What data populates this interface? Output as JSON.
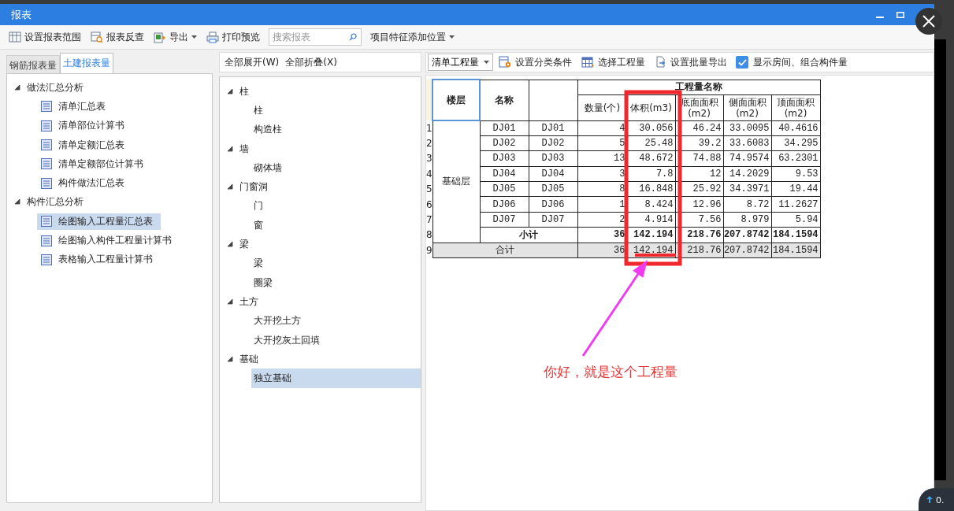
{
  "window": {
    "title": "报表"
  },
  "toolbar": [
    {
      "kind": "button",
      "label": "设置报表范围"
    },
    {
      "kind": "button",
      "label": "报表反查"
    },
    {
      "kind": "dropdown",
      "label": "导出"
    },
    {
      "kind": "button",
      "label": "打印预览"
    },
    {
      "kind": "search",
      "placeholder": "搜索报表"
    },
    {
      "kind": "dropdown",
      "label": "项目特征添加位置"
    }
  ],
  "report_tabs": [
    {
      "label": "钢筋报表量",
      "selected": false
    },
    {
      "label": "土建报表量",
      "selected": true
    }
  ],
  "report_tree": [
    {
      "label": "做法汇总分析",
      "expanded": true,
      "children": [
        {
          "label": "清单汇总表",
          "selected": false
        },
        {
          "label": "清单部位计算书",
          "selected": false
        },
        {
          "label": "清单定额汇总表",
          "selected": false
        },
        {
          "label": "清单定额部位计算书",
          "selected": false
        },
        {
          "label": "构件做法汇总表",
          "selected": false
        }
      ]
    },
    {
      "label": "构件汇总分析",
      "expanded": true,
      "children": [
        {
          "label": "绘图输入工程量汇总表",
          "selected": true
        },
        {
          "label": "绘图输入构件工程量计算书",
          "selected": false
        },
        {
          "label": "表格输入工程量计算书",
          "selected": false
        }
      ]
    }
  ],
  "component_actions": [
    "全部展开(W)",
    "全部折叠(X)"
  ],
  "component_tree": [
    {
      "label": "柱",
      "expanded": true,
      "children": [
        {
          "label": "柱",
          "selected": false
        },
        {
          "label": "构造柱",
          "selected": false
        }
      ]
    },
    {
      "label": "墙",
      "expanded": true,
      "children": [
        {
          "label": "砌体墙",
          "selected": false
        }
      ]
    },
    {
      "label": "门窗洞",
      "expanded": true,
      "children": [
        {
          "label": "门",
          "selected": false
        },
        {
          "label": "窗",
          "selected": false
        }
      ]
    },
    {
      "label": "梁",
      "expanded": true,
      "children": [
        {
          "label": "梁",
          "selected": false
        },
        {
          "label": "圈梁",
          "selected": false
        }
      ]
    },
    {
      "label": "土方",
      "expanded": true,
      "children": [
        {
          "label": "大开挖土方",
          "selected": false
        },
        {
          "label": "大开挖灰土回填",
          "selected": false
        }
      ]
    },
    {
      "label": "基础",
      "expanded": true,
      "children": [
        {
          "label": "独立基础",
          "selected": true
        }
      ]
    }
  ],
  "table_toolbar": {
    "quantity_type": "清单工程量",
    "buttons": [
      "设置分类条件",
      "选择工程量",
      "设置批量导出"
    ],
    "show_rooms": {
      "label": "显示房间、组合构件量",
      "checked": true
    }
  },
  "table": {
    "floor_header": "楼层",
    "name_header": "名称",
    "group_header": "工程量名称",
    "measures": [
      "数量(个)",
      "体积(m3)",
      "底面面积(m2)",
      "侧面面积(m2)",
      "顶面面积(m2)"
    ],
    "floor": "基础层",
    "rows": [
      {
        "no": "1",
        "name": "DJ01",
        "column_3": "DJ01",
        "values": [
          "4",
          "30.056",
          "46.24",
          "33.0095",
          "40.4616"
        ]
      },
      {
        "no": "2",
        "name": "DJ02",
        "column_3": "DJ02",
        "values": [
          "5",
          "25.48",
          "39.2",
          "33.6083",
          "34.295"
        ]
      },
      {
        "no": "3",
        "name": "DJ03",
        "column_3": "DJ03",
        "values": [
          "13",
          "48.672",
          "74.88",
          "74.9574",
          "63.2301"
        ]
      },
      {
        "no": "4",
        "name": "DJ04",
        "column_3": "DJ04",
        "values": [
          "3",
          "7.8",
          "12",
          "14.2029",
          "9.53"
        ]
      },
      {
        "no": "5",
        "name": "DJ05",
        "column_3": "DJ05",
        "values": [
          "8",
          "16.848",
          "25.92",
          "34.3971",
          "19.44"
        ]
      },
      {
        "no": "6",
        "name": "DJ06",
        "column_3": "DJ06",
        "values": [
          "1",
          "8.424",
          "12.96",
          "8.72",
          "11.2627"
        ]
      },
      {
        "no": "7",
        "name": "DJ07",
        "column_3": "DJ07",
        "values": [
          "2",
          "4.914",
          "7.56",
          "8.979",
          "5.94"
        ]
      }
    ],
    "subtotal": {
      "no": "8",
      "label": "小计",
      "values": [
        "36",
        "142.194",
        "218.76",
        "207.8742",
        "184.1594"
      ]
    },
    "total": {
      "no": "9",
      "label": "合计",
      "values": [
        "36",
        "142.194",
        "218.76",
        "207.8742",
        "184.1594"
      ]
    }
  },
  "annotation": {
    "note": "你好，就是这个工程量"
  },
  "corner_badge": "0."
}
